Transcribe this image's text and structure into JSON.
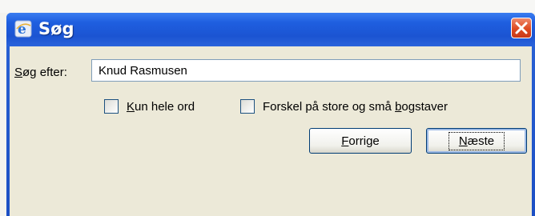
{
  "window": {
    "title": "Søg"
  },
  "search": {
    "label": "Søg efter:",
    "value": "Knud Rasmusen"
  },
  "options": {
    "whole_word_label": "Kun hele ord",
    "match_case_label": "Forskel på store og små bogstaver"
  },
  "buttons": {
    "previous_label": "Forrige",
    "next_label": "Næste"
  },
  "colors": {
    "titlebar": "#1f5fe0",
    "close": "#de4a21",
    "client": "#ece9d8"
  }
}
